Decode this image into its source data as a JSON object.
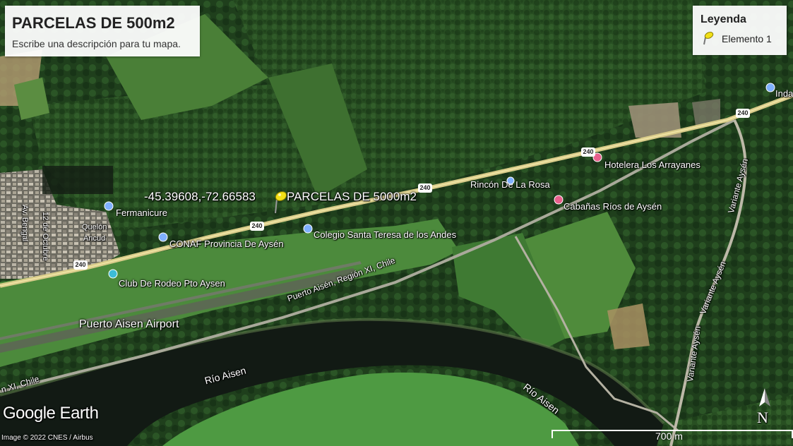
{
  "title": "PARCELAS DE 500m2",
  "description": "Escribe una descripción para tu mapa.",
  "legend": {
    "title": "Leyenda",
    "items": [
      {
        "label": "Elemento 1",
        "icon": "yellow-pushpin-icon"
      }
    ]
  },
  "placemark": {
    "coords": "-45.39608,-72.66583",
    "name": "PARCELAS DE 5000m2"
  },
  "pois": {
    "fermanicure": "Fermanicure",
    "quelon": "Quelón",
    "ancud": "Ancud",
    "conaf": "CONAF Provincia De Aysén",
    "colegio": "Colegio Santa Teresa de los Andes",
    "rincon": "Rincón De La Rosa",
    "hotelera": "Hotelera Los Arrayanes",
    "cabanas": "Cabañas Ríos de Aysén",
    "club_rodeo": "Club De Rodeo Pto Aysen",
    "airport": "Puerto Aisen Airport",
    "inda": "Inda"
  },
  "roads": {
    "route_number": "240",
    "puerto_aisen_road": "Puerto Aisén, Región XI, Chile",
    "region_edge": "n XI, Chile",
    "variante_1": "Variante Aysén",
    "variante_2": "Variante Aysén",
    "variante_3": "Variante Aysén",
    "av_bengal": "Av. Bengal",
    "doce_octubre": "12 de Octubre"
  },
  "water": {
    "river_1": "Río Aisen",
    "river_2": "Río Aisen"
  },
  "branding": "Google Earth",
  "attribution": "Image © 2022 CNES / Airbus",
  "scale": "700 m",
  "north": "N",
  "colors": {
    "forest_dark": "#1d3a1a",
    "forest": "#2f5a28",
    "field": "#4d8a3a",
    "river": "#121a14",
    "road": "#d9cc8a"
  }
}
